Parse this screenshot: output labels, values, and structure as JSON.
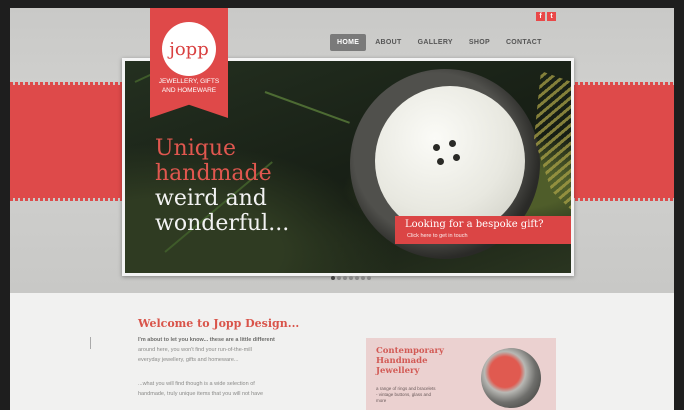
{
  "brand": {
    "logo": "jopp",
    "tagline_line1": "JEWELLERY, GIFTS",
    "tagline_line2": "AND HOMEWARE"
  },
  "social": [
    {
      "icon": "facebook-icon",
      "glyph": "f"
    },
    {
      "icon": "twitter-icon",
      "glyph": "t"
    }
  ],
  "nav": [
    {
      "label": "HOME",
      "active": true
    },
    {
      "label": "ABOUT"
    },
    {
      "label": "GALLERY"
    },
    {
      "label": "SHOP"
    },
    {
      "label": "CONTACT"
    }
  ],
  "hero": {
    "headline_red_1": "Unique",
    "headline_red_2": "handmade",
    "headline_white_1": "weird and",
    "headline_white_2": "wonderful..."
  },
  "cta": {
    "title": "Looking for a bespoke gift?",
    "subtitle": "Click here to get in touch"
  },
  "slider_dots": {
    "count": 7,
    "active_index": 0
  },
  "welcome": {
    "title": "Welcome to Jopp Design...",
    "para1": "I'm about to let you know... these are a little different",
    "para2": "around here, you won't find your run-of-the-mill",
    "para3": "everyday jewellery, gifts and homeware...",
    "para4": "...what you will find though is a wide selection of",
    "para5": "handmade, truly unique items that you will not have"
  },
  "promo": {
    "title_line1": "Contemporary",
    "title_line2": "Handmade",
    "title_line3": "Jewellery",
    "subtitle": "a range of rings and bracelets - vintage buttons, glass and more"
  },
  "colors": {
    "accent": "#de4a4a",
    "nav_active": "#7a7a7a",
    "page_bg": "#d6d6d4"
  }
}
